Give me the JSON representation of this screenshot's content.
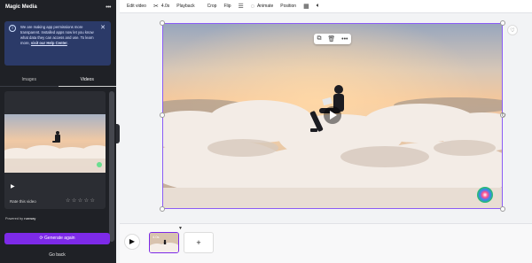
{
  "panel": {
    "title": "Magic Media",
    "menu_icon": "more-dots",
    "notice": {
      "text": "We are making app permissions more transparent. Installed apps now let you know what data they can access and use. To learn more, ",
      "link": "visit our Help Center",
      "tail": "."
    },
    "tabs": [
      {
        "label": "Images",
        "active": false
      },
      {
        "label": "Videos",
        "active": true
      }
    ],
    "card": {
      "rate_label": "Rate this video",
      "stars": "☆☆☆☆☆"
    },
    "powered_by": "Powered by",
    "powered_brand": "runway",
    "generate_label": "Generate again",
    "back_label": "Go back"
  },
  "toolbar": {
    "edit_video": "Edit video",
    "duration": "4.0s",
    "playback": "Playback",
    "crop": "Crop",
    "flip": "Flip",
    "animate": "Animate",
    "position": "Position"
  },
  "timeline": {
    "clip_duration": "4.0s"
  },
  "colors": {
    "accent": "#7d2ae8",
    "panel_bg": "#1f2126",
    "notice_bg": "#2b3a68"
  }
}
